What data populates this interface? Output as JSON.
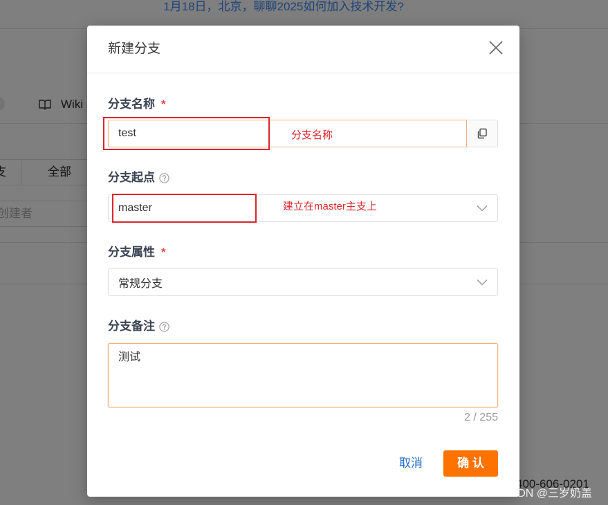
{
  "background": {
    "banner_text": "1月18日，北京，聊聊2025如何加入技术开发?",
    "wiki_label": "Wiki",
    "branch_tab_partial": "支",
    "all_tab": "全部",
    "creator_placeholder": "创建者",
    "phone": "400-606-0201"
  },
  "dialog": {
    "title": "新建分支",
    "fields": {
      "name": {
        "label": "分支名称",
        "required": "*",
        "value": "test"
      },
      "source": {
        "label": "分支起点",
        "value": "master"
      },
      "type": {
        "label": "分支属性",
        "required": "*",
        "value": "常规分支"
      },
      "note": {
        "label": "分支备注",
        "value": "测试",
        "counter": "2 / 255"
      }
    },
    "cancel_label": "取消",
    "confirm_label": "确 认"
  },
  "annotations": {
    "name_note": "分支名称",
    "source_note": "建立在master主支上"
  },
  "watermark": "CSDN @三岁奶盖",
  "icons": {
    "close": "close-icon",
    "copy": "copy-icon",
    "help": "help-icon",
    "dropdown": "chevron-down-icon",
    "wiki": "book-icon"
  },
  "colors": {
    "primary_button": "#fe7300",
    "link": "#1f6cc5",
    "focus_border": "#f5b07a",
    "required_mark": "#e04a4a",
    "annotation": "#d9262b",
    "overlay": "rgba(0,0,0,0.5)"
  }
}
